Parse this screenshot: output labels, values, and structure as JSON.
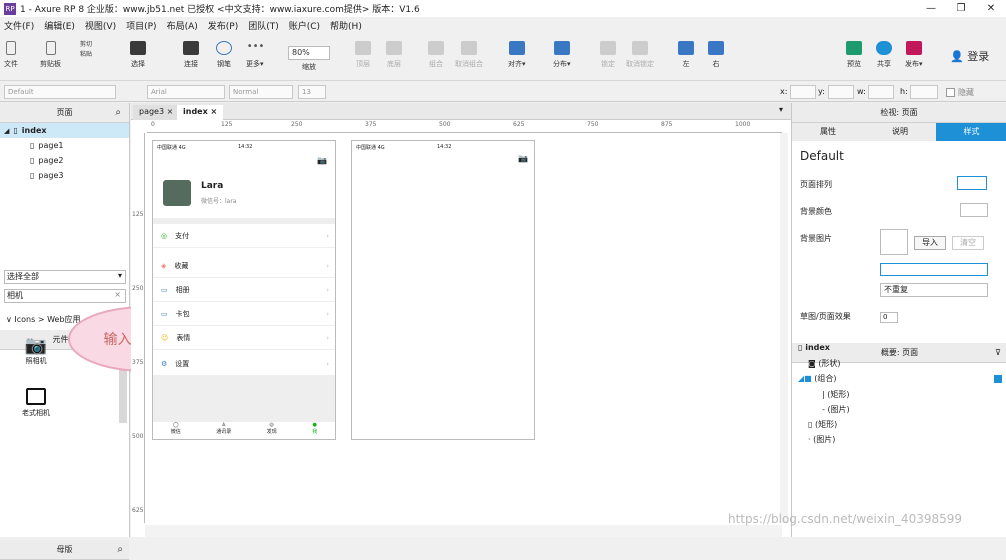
{
  "window": {
    "title": "1 - Axure RP 8 企业版：www.jb51.net 已授权    <中文支持：www.iaxure.com提供> 版本：V1.6",
    "min": "—",
    "max": "❐",
    "close": "✕"
  },
  "menu": [
    "文件(F)",
    "编辑(E)",
    "视图(V)",
    "项目(P)",
    "布局(A)",
    "发布(P)",
    "团队(T)",
    "账户(C)",
    "帮助(H)"
  ],
  "toolbar": {
    "file": "文件",
    "clipboard": "剪贴板",
    "cut": "剪切",
    "copy": "复制",
    "paste": "粘贴",
    "select": "选择",
    "connect": "连接",
    "pen": "钢笔",
    "more": "更多▾",
    "zoom": "80%",
    "zoom_label": "缩放",
    "top": "顶层",
    "bottom": "底层",
    "group": "组合",
    "ungroup": "取消组合",
    "align": "对齐▾",
    "distribute": "分布▾",
    "lock": "锁定",
    "unlock": "取消锁定",
    "left": "左",
    "right": "右",
    "preview": "预览",
    "share": "共享",
    "publish": "发布▾",
    "login": "登录"
  },
  "stylebar": {
    "style": "Default",
    "font": "Arial",
    "weight": "Normal",
    "size": "13",
    "x": "x:",
    "y": "y:",
    "w": "w:",
    "h": "h:",
    "hide": "隐藏"
  },
  "pages_panel": {
    "title": "页面",
    "root": "index",
    "pages": [
      "page1",
      "page2",
      "page3"
    ]
  },
  "library_panel": {
    "title": "元件库",
    "select": "选择全部",
    "search": "相机",
    "category": "Icons > Web应用",
    "items": [
      "照相机",
      "老式相机"
    ]
  },
  "masters_panel": {
    "title": "母版"
  },
  "bubble": "输入相机搜索",
  "tabs": [
    "page3",
    "index"
  ],
  "ruler_h": [
    "0",
    "125",
    "250",
    "375",
    "500",
    "625",
    "750",
    "875",
    "1000"
  ],
  "ruler_v": [
    "125",
    "250",
    "375",
    "500",
    "625"
  ],
  "phone1": {
    "carrier": "中国联通 4G",
    "time": "14:32",
    "name": "Lara",
    "wechat": "微信号：lara",
    "items": [
      "支付",
      "收藏",
      "相册",
      "卡包",
      "表情",
      "设置"
    ],
    "nav": [
      "微信",
      "通讯录",
      "发现",
      "我"
    ]
  },
  "phone2": {
    "carrier": "中国联通 4G",
    "time": "14:32"
  },
  "inspector": {
    "title": "检视: 页面",
    "tabs": [
      "属性",
      "说明",
      "样式"
    ],
    "style": "Default",
    "page_align": "页面排列",
    "bg_color": "背景颜色",
    "bg_image": "背景图片",
    "import": "导入",
    "clear": "清空",
    "repeat": "不重复",
    "sketch": "草图/页面效果",
    "sketch_val": "0"
  },
  "outline": {
    "title": "概要: 页面",
    "items": [
      "index",
      "(形状)",
      "(组合)",
      "(矩形)",
      "(图片)",
      "(矩形)",
      "(图片)"
    ]
  },
  "watermark": "https://blog.csdn.net/weixin_40398599",
  "colors": {
    "accent": "#1e90d6",
    "wechat_green": "#1aad19",
    "bubble": "#f9d9e3"
  }
}
